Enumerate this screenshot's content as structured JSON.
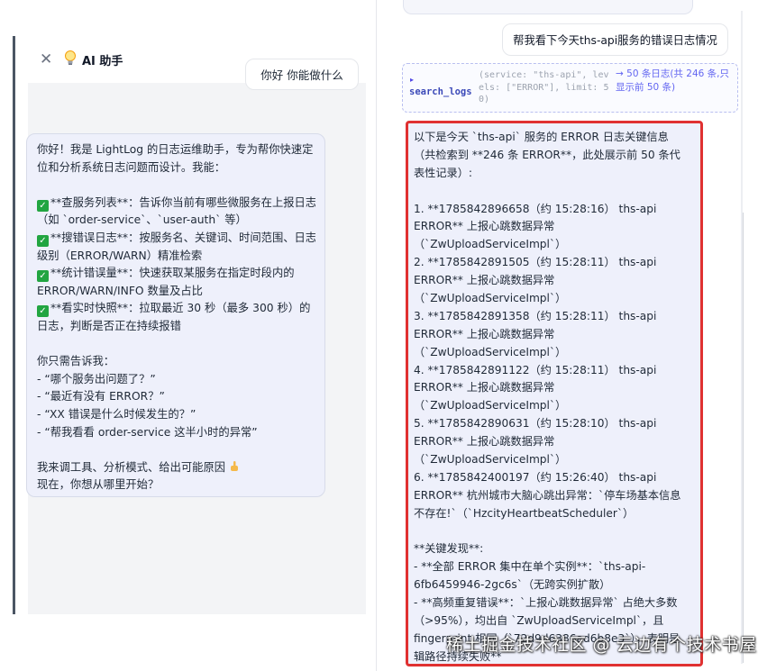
{
  "left_panel": {
    "title": "AI 助手",
    "close_icon": "close-icon",
    "bulb_icon": "lightbulb-icon",
    "user_message": "你好 你能做什么",
    "assistant_message": {
      "lines": [
        "你好！我是 LightLog 的日志运维助手，专为帮你快速定",
        "位和分析系统日志问题而设计。我能：",
        "",
        "**查服务列表**：告诉你当前有哪些微服务在上报日志",
        "（如 `order-service`、`user-auth` 等）",
        "**搜错误日志**：按服务名、关键词、时间范围、日志",
        "级别（ERROR/WARN）精准检索",
        "**统计错误量**：快速获取某服务在指定时段内的",
        "ERROR/WARN/INFO 数量及占比",
        "**看实时快照**：拉取最近 30 秒（最多 300 秒）的",
        "日志，判断是否正在持续报错",
        "",
        "你只需告诉我：",
        "- “哪个服务出问题了？”",
        "- “最近有没有 ERROR？”",
        "- “XX 错误是什么时候发生的？”",
        "- “帮我看看 order-service 这半小时的异常”",
        "",
        "我来调工具、分析模式、给出可能原因",
        "现在，你想从哪里开始？"
      ],
      "check_lines": [
        3,
        5,
        7,
        9
      ],
      "check_icon": "check-mark-icon",
      "hand_icon": "pointing-hand-icon"
    }
  },
  "right_panel": {
    "user_message": "帮我看下今天ths-api服务的错误日志情况",
    "tool_call": {
      "arrow": "▸",
      "name": "search_logs",
      "args": "(service: \"ths-api\", levels: [\"ERROR\"], limit: 50)",
      "result": "→ 50 条日志(共 246 条,只显示前 50 条)"
    },
    "assistant_message": {
      "lines": [
        "以下是今天 `ths-api` 服务的 ERROR 日志关键信息",
        "（共检索到 **246 条 ERROR**，此处展示前 50 条代",
        "表性记录）:",
        "",
        "1. **1785842896658（约 15:28:16） ths-api",
        "ERROR** 上报心跳数据异常",
        "（`ZwUploadServiceImpl`）",
        "2. **1785842891505（约 15:28:11） ths-api",
        "ERROR** 上报心跳数据异常",
        "（`ZwUploadServiceImpl`）",
        "3. **1785842891358（约 15:28:11） ths-api",
        "ERROR** 上报心跳数据异常",
        "（`ZwUploadServiceImpl`）",
        "4. **1785842891122（约 15:28:11） ths-api",
        "ERROR** 上报心跳数据异常",
        "（`ZwUploadServiceImpl`）",
        "5. **1785842890631（约 15:28:10） ths-api",
        "ERROR** 上报心跳数据异常",
        "（`ZwUploadServiceImpl`）",
        "6. **1785842400197（约 15:26:40） ths-api",
        "ERROR** 杭州城市大脑心跳出异常：`停车场基本信息",
        "不存在!`（`HzcityHeartbeatScheduler`）",
        "",
        "**关键发现**:",
        "- **全部 ERROR 集中在单个实例**：`ths-api-",
        "6fb6459946-2gc6s`（无跨实例扩散）",
        "- **高频重复错误**：`上报心跳数据异常` 占绝大多数",
        "（>95%），均出自 `ZwUploadServiceImpl`，且",
        "fingerprint 相同（`72d9d6386ad6b8e3`），表明是",
        "辑路径持续失败**"
      ]
    }
  },
  "watermark": "稀土掘金技术社区 @ 云边有个技术书屋"
}
